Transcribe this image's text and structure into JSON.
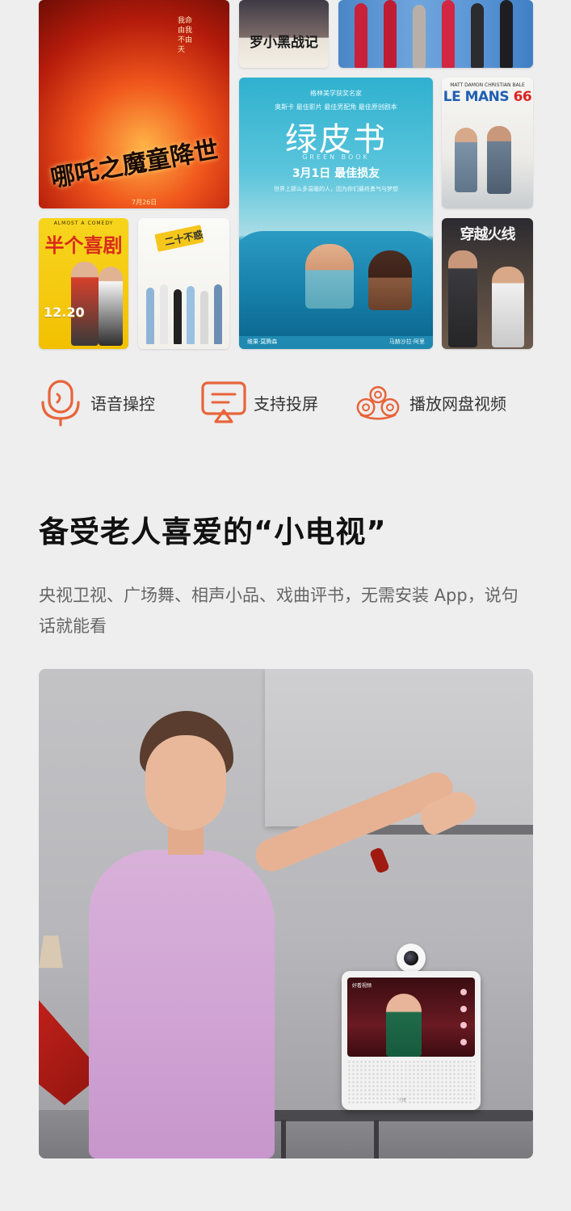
{
  "posters": {
    "nezha": {
      "title": "哪吒之魔童降世",
      "tagline": "我命由我不由天",
      "caption": "7月26日"
    },
    "ji": {
      "title": "罗小黑战记"
    },
    "green_book": {
      "top1": "格林美学获奖名家",
      "top2": "奥斯卡 最佳影片 最佳男配角 最佳原创剧本",
      "title": "绿皮书",
      "en": "GREEN BOOK",
      "date": "3月1日 最佳损友",
      "tagline": "世界上那么多温暖的人，因为你们最终勇气与梦想",
      "name_left": "维果·莫腾森",
      "name_right": "马赫沙拉·阿里"
    },
    "le_mans": {
      "cast": "MATT DAMON  CHRISTIAN BALE",
      "title_a": "LE MANS",
      "title_b": "66"
    },
    "half": {
      "top": "ALMOST A COMEDY",
      "title": "半个喜剧",
      "date": "12.20"
    },
    "ershi": {
      "title": "二十不惑"
    },
    "chuanyue": {
      "title": "穿越火线"
    }
  },
  "features": [
    {
      "icon": "microphone-icon",
      "label": "语音操控"
    },
    {
      "icon": "screen-cast-icon",
      "label": "支持投屏"
    },
    {
      "icon": "cloud-disk-icon",
      "label": "播放网盘视频"
    }
  ],
  "headline": "备受老人喜爱的“小电视”",
  "description": "央视卫视、广场舞、相声小品、戏曲评书，无需安装 App，说句话就能看",
  "device": {
    "screen_brand": "好看视频",
    "logo": "小度"
  },
  "colors": {
    "accent": "#e8643a",
    "page_bg": "#eeeeef"
  }
}
